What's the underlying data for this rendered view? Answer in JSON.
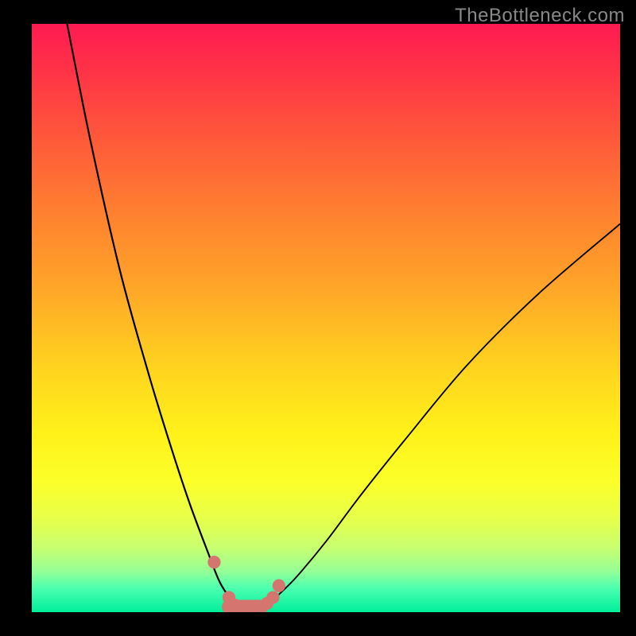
{
  "watermark": "TheBottleneck.com",
  "colors": {
    "background": "#000000",
    "gradient_top": "#ff1a52",
    "gradient_bottom": "#00ef9a",
    "curve": "#000000",
    "marker_fill": "#d5756f",
    "marker_stroke": "#d5756f"
  },
  "chart_data": {
    "type": "line",
    "title": "",
    "xlabel": "",
    "ylabel": "",
    "xlim": [
      0,
      100
    ],
    "ylim": [
      0,
      100
    ],
    "grid": false,
    "series": [
      {
        "name": "left-curve",
        "x": [
          6,
          10,
          15,
          20,
          24,
          27,
          30,
          32,
          34,
          35.5
        ],
        "y": [
          100,
          80,
          58,
          40,
          27,
          18,
          10,
          5,
          2,
          0.5
        ]
      },
      {
        "name": "right-curve",
        "x": [
          40,
          42,
          45,
          50,
          56,
          64,
          74,
          86,
          100
        ],
        "y": [
          1,
          3,
          6,
          12,
          20,
          30,
          42,
          54,
          66
        ]
      },
      {
        "name": "markers-salmon",
        "x": [
          31,
          33.5,
          34.5,
          36,
          37.5,
          39,
          40,
          41,
          42
        ],
        "y": [
          8.5,
          2.5,
          1.2,
          0.8,
          0.8,
          1,
          1.5,
          2.5,
          4.5
        ]
      }
    ],
    "marker_radius": 1.1,
    "bottom_stroke": {
      "x1": 33.5,
      "x2": 39,
      "y": 0.9,
      "width": 2.4
    }
  }
}
